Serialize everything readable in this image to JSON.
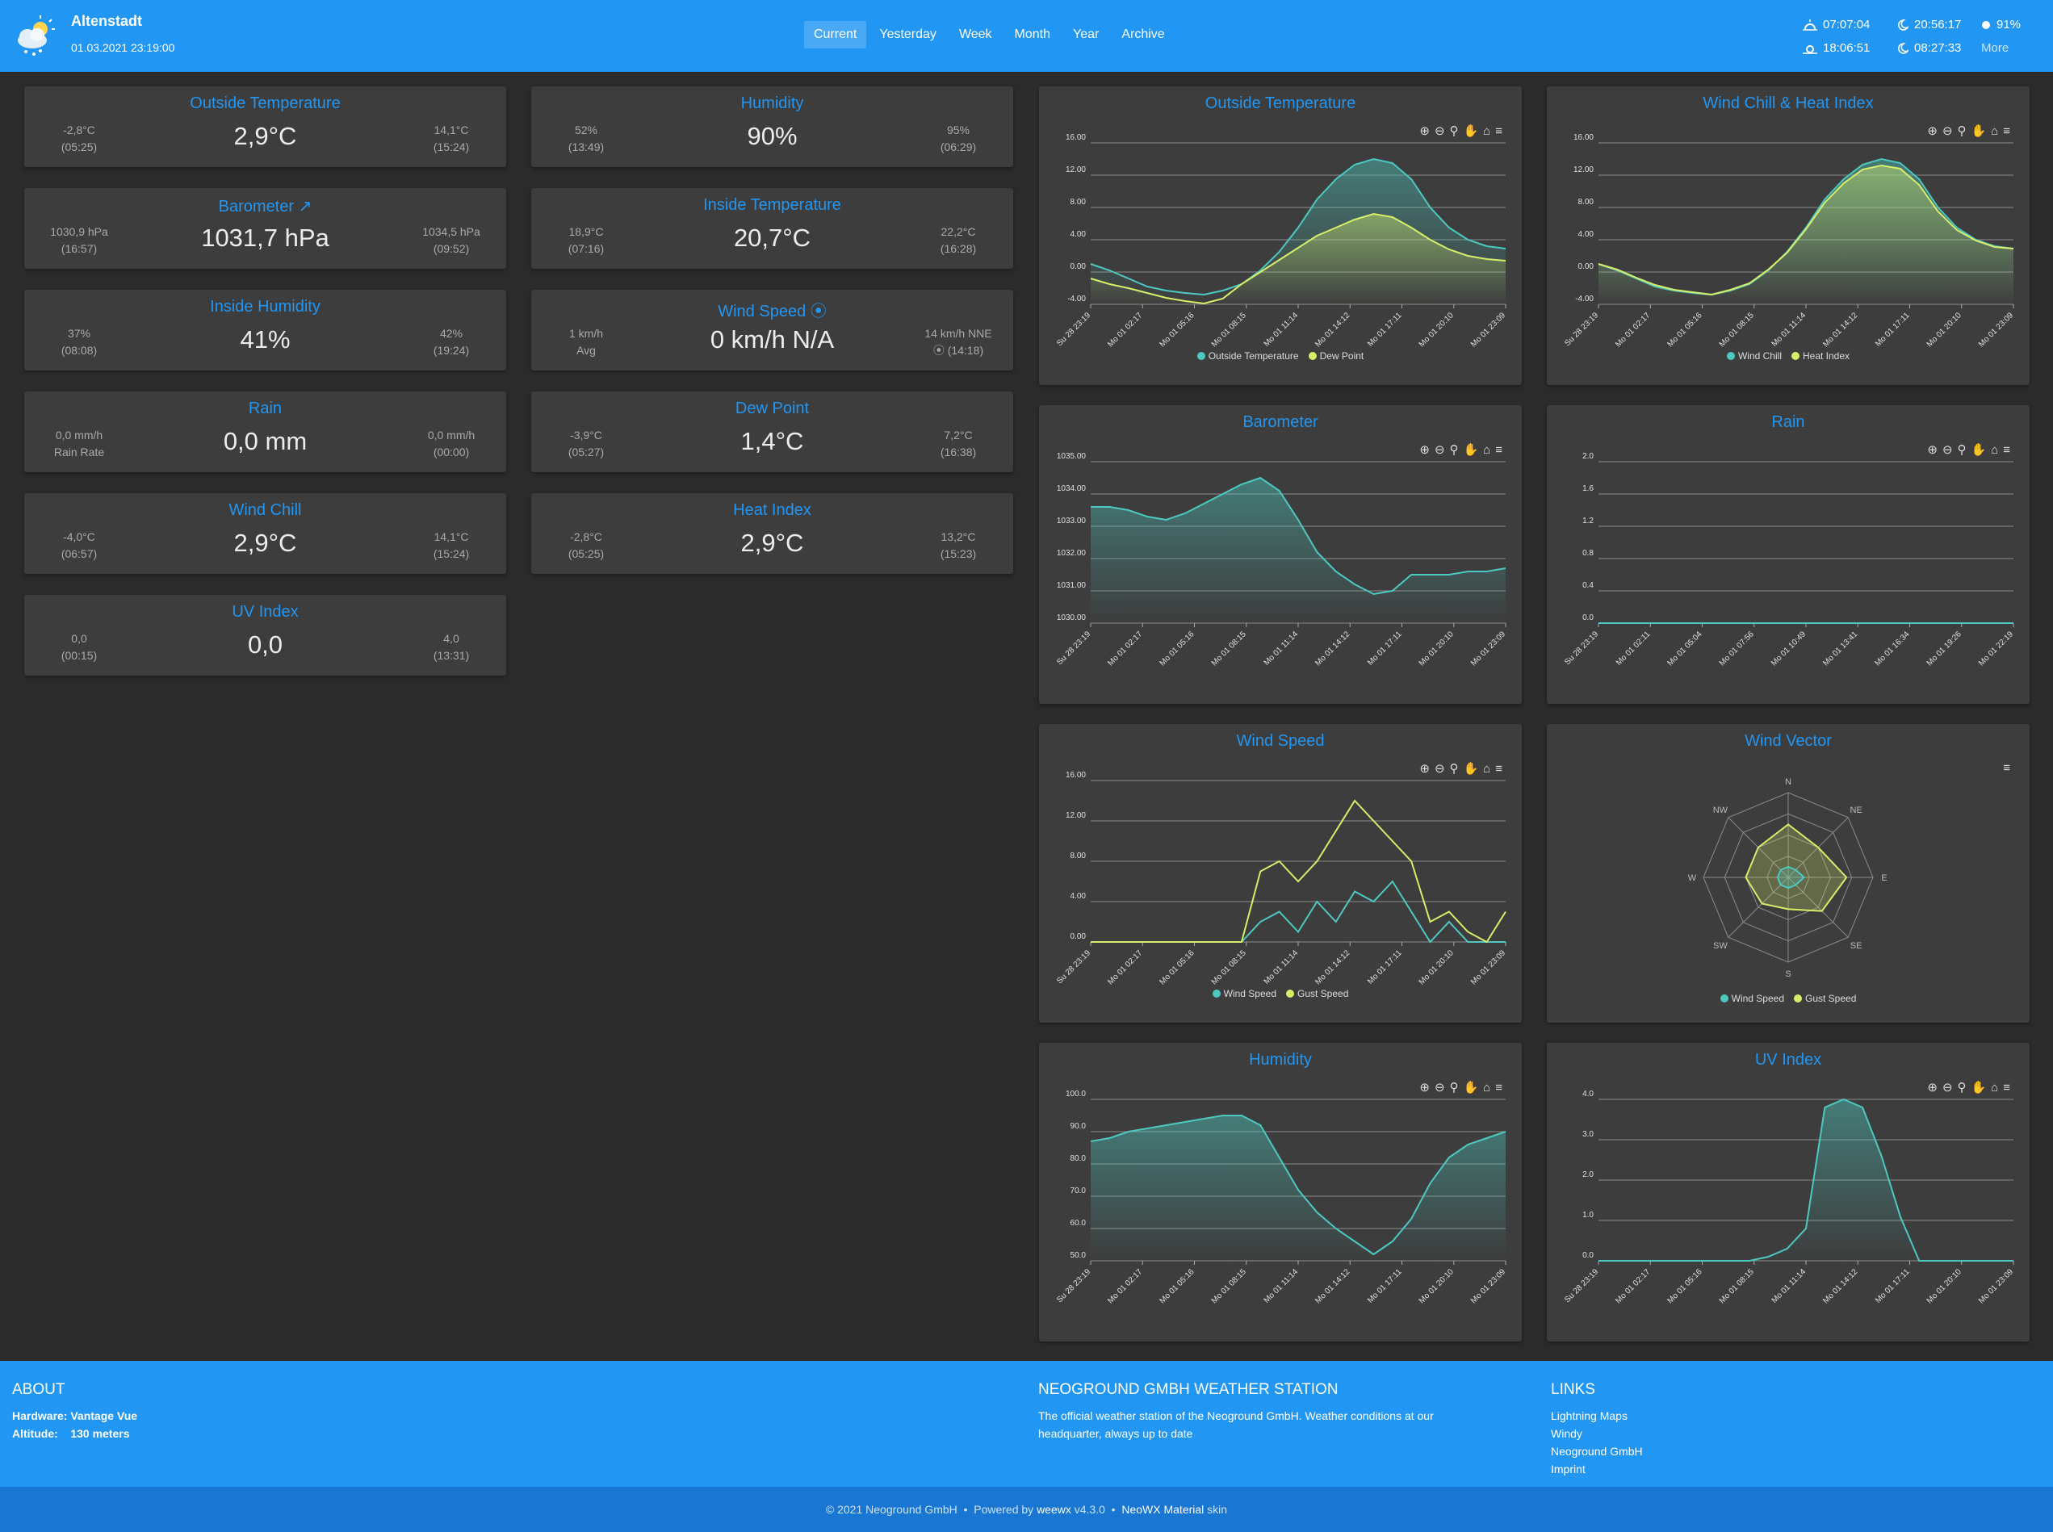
{
  "header": {
    "station": "Altenstadt",
    "datetime": "01.03.2021 23:19:00",
    "nav": [
      "Current",
      "Yesterday",
      "Week",
      "Month",
      "Year",
      "Archive"
    ],
    "sunrise": "07:07:04",
    "sunset": "18:06:51",
    "moonrise": "20:56:17",
    "moonset": "08:27:33",
    "moon_phase": "91%",
    "more": "More"
  },
  "cards": [
    {
      "title": "Outside Temperature",
      "value": "2,9°C",
      "min": "-2,8°C",
      "min_time": "(05:25)",
      "max": "14,1°C",
      "max_time": "(15:24)"
    },
    {
      "title": "Humidity",
      "value": "90%",
      "min": "52%",
      "min_time": "(13:49)",
      "max": "95%",
      "max_time": "(06:29)"
    },
    {
      "title": "Barometer ↗",
      "value": "1031,7 hPa",
      "min": "1030,9 hPa",
      "min_time": "(16:57)",
      "max": "1034,5 hPa",
      "max_time": "(09:52)"
    },
    {
      "title": "Inside Temperature",
      "value": "20,7°C",
      "min": "18,9°C",
      "min_time": "(07:16)",
      "max": "22,2°C",
      "max_time": "(16:28)"
    },
    {
      "title": "Inside Humidity",
      "value": "41%",
      "min": "37%",
      "min_time": "(08:08)",
      "max": "42%",
      "max_time": "(19:24)"
    },
    {
      "title": "Wind Speed ⦿",
      "value": "0 km/h N/A",
      "min": "1 km/h",
      "min_time": "Avg",
      "max": "14 km/h NNE",
      "max_time": "⦿ (14:18)"
    },
    {
      "title": "Rain",
      "value": "0,0 mm",
      "min": "0,0 mm/h",
      "min_time": "Rain Rate",
      "max": "0,0 mm/h",
      "max_time": "(00:00)"
    },
    {
      "title": "Dew Point",
      "value": "1,4°C",
      "min": "-3,9°C",
      "min_time": "(05:27)",
      "max": "7,2°C",
      "max_time": "(16:38)"
    },
    {
      "title": "Wind Chill",
      "value": "2,9°C",
      "min": "-4,0°C",
      "min_time": "(06:57)",
      "max": "14,1°C",
      "max_time": "(15:24)"
    },
    {
      "title": "Heat Index",
      "value": "2,9°C",
      "min": "-2,8°C",
      "min_time": "(05:25)",
      "max": "13,2°C",
      "max_time": "(15:23)"
    },
    {
      "title": "UV Index",
      "value": "0,0",
      "min": "0,0",
      "min_time": "(00:15)",
      "max": "4,0",
      "max_time": "(13:31)"
    }
  ],
  "colors": {
    "accent": "#2196f3",
    "teal": "#4dc9c1",
    "yellow": "#d7ee6a",
    "card": "#3d3d3d",
    "bg": "#2b2b2b"
  },
  "chart_data": [
    {
      "type": "area",
      "title": "Outside Temperature",
      "y_ticks": [
        "16.00",
        "12.00",
        "8.00",
        "4.00",
        "0.00",
        "-4.00"
      ],
      "ylim": [
        -4,
        16
      ],
      "x_ticks": [
        "Su 28 23:19",
        "Mo 01 02:17",
        "Mo 01 05:16",
        "Mo 01 08:15",
        "Mo 01 11:14",
        "Mo 01 14:12",
        "Mo 01 17:11",
        "Mo 01 20:10",
        "Mo 01 23:09"
      ],
      "series": [
        {
          "name": "Outside Temperature",
          "values": [
            1.0,
            0.2,
            -0.8,
            -1.8,
            -2.3,
            -2.6,
            -2.8,
            -2.3,
            -1.5,
            0.2,
            2.5,
            5.5,
            9.0,
            11.5,
            13.3,
            14.0,
            13.5,
            11.5,
            8.0,
            5.5,
            4.0,
            3.2,
            2.9
          ]
        },
        {
          "name": "Dew Point",
          "values": [
            -0.8,
            -1.5,
            -2.0,
            -2.6,
            -3.2,
            -3.6,
            -3.9,
            -3.3,
            -1.5,
            0.0,
            1.5,
            3.0,
            4.5,
            5.5,
            6.5,
            7.2,
            6.8,
            5.5,
            4.0,
            2.8,
            2.0,
            1.6,
            1.4
          ]
        }
      ]
    },
    {
      "type": "area",
      "title": "Wind Chill & Heat Index",
      "y_ticks": [
        "16.00",
        "12.00",
        "8.00",
        "4.00",
        "0.00",
        "-4.00"
      ],
      "ylim": [
        -4,
        16
      ],
      "x_ticks": [
        "Su 28 23:19",
        "Mo 01 02:17",
        "Mo 01 05:16",
        "Mo 01 08:15",
        "Mo 01 11:14",
        "Mo 01 14:12",
        "Mo 01 17:11",
        "Mo 01 20:10",
        "Mo 01 23:09"
      ],
      "series": [
        {
          "name": "Wind Chill",
          "values": [
            1.0,
            0.2,
            -0.8,
            -1.8,
            -2.3,
            -2.6,
            -2.8,
            -2.3,
            -1.5,
            0.2,
            2.5,
            5.5,
            9.0,
            11.5,
            13.3,
            14.0,
            13.5,
            11.5,
            8.0,
            5.5,
            4.0,
            3.2,
            2.9
          ]
        },
        {
          "name": "Heat Index",
          "values": [
            1.0,
            0.3,
            -0.7,
            -1.6,
            -2.2,
            -2.5,
            -2.8,
            -2.2,
            -1.4,
            0.3,
            2.4,
            5.3,
            8.6,
            11.0,
            12.7,
            13.2,
            12.8,
            10.8,
            7.5,
            5.2,
            3.9,
            3.1,
            2.9
          ]
        }
      ]
    },
    {
      "type": "area",
      "title": "Barometer",
      "y_ticks": [
        "1035.00",
        "1034.00",
        "1033.00",
        "1032.00",
        "1031.00",
        "1030.00"
      ],
      "ylim": [
        1030,
        1035
      ],
      "x_ticks": [
        "Su 28 23:19",
        "Mo 01 02:17",
        "Mo 01 05:16",
        "Mo 01 08:15",
        "Mo 01 11:14",
        "Mo 01 14:12",
        "Mo 01 17:11",
        "Mo 01 20:10",
        "Mo 01 23:09"
      ],
      "series": [
        {
          "name": "Barometer",
          "values": [
            1033.6,
            1033.6,
            1033.5,
            1033.3,
            1033.2,
            1033.4,
            1033.7,
            1034.0,
            1034.3,
            1034.5,
            1034.1,
            1033.2,
            1032.2,
            1031.6,
            1031.2,
            1030.9,
            1031.0,
            1031.5,
            1031.5,
            1031.5,
            1031.6,
            1031.6,
            1031.7
          ]
        }
      ]
    },
    {
      "type": "line",
      "title": "Rain",
      "y_ticks": [
        "2.0",
        "1.6",
        "1.2",
        "0.8",
        "0.4",
        "0.0"
      ],
      "ylim": [
        0,
        2
      ],
      "x_ticks": [
        "Su 28 23:19",
        "Mo 01 02:11",
        "Mo 01 05:04",
        "Mo 01 07:56",
        "Mo 01 10:49",
        "Mo 01 13:41",
        "Mo 01 16:34",
        "Mo 01 19:26",
        "Mo 01 22:19"
      ],
      "series": [
        {
          "name": "Rain",
          "values": [
            0,
            0,
            0,
            0,
            0,
            0,
            0,
            0,
            0,
            0,
            0,
            0,
            0,
            0,
            0,
            0,
            0,
            0,
            0,
            0,
            0,
            0,
            0
          ]
        }
      ]
    },
    {
      "type": "line",
      "title": "Wind Speed",
      "y_ticks": [
        "16.00",
        "12.00",
        "8.00",
        "4.00",
        "0.00"
      ],
      "ylim": [
        0,
        16
      ],
      "x_ticks": [
        "Su 28 23:19",
        "Mo 01 02:17",
        "Mo 01 05:16",
        "Mo 01 08:15",
        "Mo 01 11:14",
        "Mo 01 14:12",
        "Mo 01 17:11",
        "Mo 01 20:10",
        "Mo 01 23:09"
      ],
      "series": [
        {
          "name": "Wind Speed",
          "values": [
            0,
            0,
            0,
            0,
            0,
            0,
            0,
            0,
            0,
            2,
            3,
            1,
            4,
            2,
            5,
            4,
            6,
            3,
            0,
            2,
            0,
            0,
            0
          ]
        },
        {
          "name": "Gust Speed",
          "values": [
            0,
            0,
            0,
            0,
            0,
            0,
            0,
            0,
            0,
            7,
            8,
            6,
            8,
            11,
            14,
            12,
            10,
            8,
            2,
            3,
            1,
            0,
            3
          ]
        }
      ]
    },
    {
      "type": "radar",
      "title": "Wind Vector",
      "categories": [
        "N",
        "NE",
        "E",
        "SE",
        "S",
        "SW",
        "W",
        "NW"
      ],
      "r_ticks": [
        "16",
        "12",
        "8",
        "4",
        "0"
      ],
      "series": [
        {
          "name": "Wind Speed",
          "values": [
            2,
            2,
            3,
            2,
            2,
            2,
            2,
            2
          ]
        },
        {
          "name": "Gust Speed",
          "values": [
            10,
            8,
            11,
            9,
            6,
            7,
            8,
            8
          ]
        }
      ]
    },
    {
      "type": "area",
      "title": "Humidity",
      "y_ticks": [
        "100.0",
        "90.0",
        "80.0",
        "70.0",
        "60.0",
        "50.0"
      ],
      "ylim": [
        50,
        100
      ],
      "x_ticks": [
        "Su 28 23:19",
        "Mo 01 02:17",
        "Mo 01 05:16",
        "Mo 01 08:15",
        "Mo 01 11:14",
        "Mo 01 14:12",
        "Mo 01 17:11",
        "Mo 01 20:10",
        "Mo 01 23:09"
      ],
      "series": [
        {
          "name": "Humidity",
          "values": [
            87,
            88,
            90,
            91,
            92,
            93,
            94,
            95,
            95,
            92,
            82,
            72,
            65,
            60,
            56,
            52,
            56,
            63,
            74,
            82,
            86,
            88,
            90
          ]
        }
      ]
    },
    {
      "type": "area",
      "title": "UV Index",
      "y_ticks": [
        "4.0",
        "3.0",
        "2.0",
        "1.0",
        "0.0"
      ],
      "ylim": [
        0,
        4
      ],
      "x_ticks": [
        "Su 28 23:19",
        "Mo 01 02:17",
        "Mo 01 05:16",
        "Mo 01 08:15",
        "Mo 01 11:14",
        "Mo 01 14:12",
        "Mo 01 17:11",
        "Mo 01 20:10",
        "Mo 01 23:09"
      ],
      "series": [
        {
          "name": "UV Index",
          "values": [
            0,
            0,
            0,
            0,
            0,
            0,
            0,
            0,
            0,
            0.1,
            0.3,
            0.8,
            3.8,
            4.0,
            3.8,
            2.6,
            1.1,
            0,
            0,
            0,
            0,
            0,
            0
          ]
        }
      ]
    }
  ],
  "footer": {
    "about_title": "ABOUT",
    "hardware_label": "Hardware:",
    "hardware": "Vantage Vue",
    "altitude_label": "Altitude:",
    "altitude": "130 meters",
    "station_title": "NEOGROUND GMBH WEATHER STATION",
    "station_text": "The official weather station of the Neoground GmbH. Weather conditions at our headquarter, always up to date",
    "links_title": "LINKS",
    "links": [
      "Lightning Maps",
      "Windy",
      "Neoground GmbH",
      "Imprint"
    ],
    "copyright": "© 2021 Neoground GmbH",
    "powered": "Powered by",
    "weewx": "weewx",
    "weewx_version": "v4.3.0",
    "skin": "NeoWX Material",
    "skin_word": "skin"
  }
}
